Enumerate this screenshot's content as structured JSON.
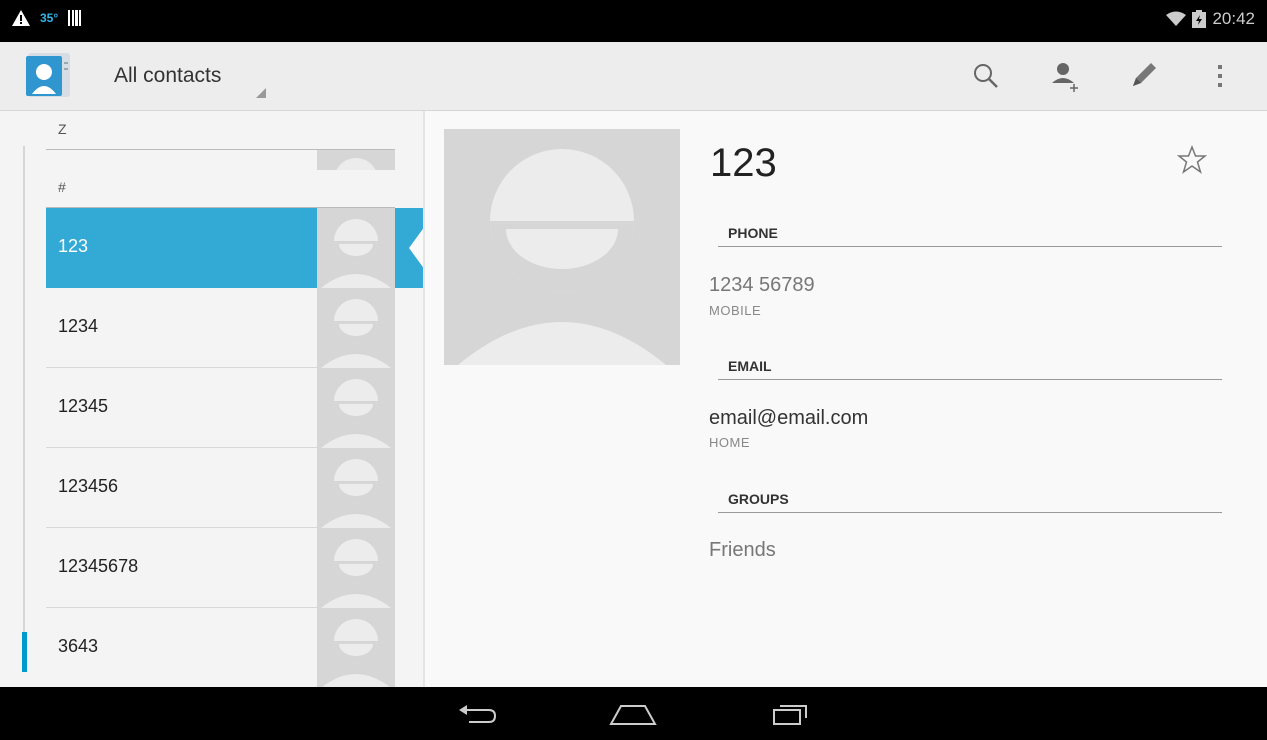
{
  "status_bar": {
    "time": "20:42",
    "temperature": "35°",
    "icons": [
      "warning-icon",
      "temperature-icon",
      "barcode-icon",
      "wifi-icon",
      "battery-icon"
    ]
  },
  "action_bar": {
    "filter_label": "All contacts",
    "actions": [
      "search-icon",
      "add-contact-icon",
      "edit-icon",
      "overflow-menu-icon"
    ]
  },
  "contact_list": {
    "sections": [
      "Z",
      "#"
    ],
    "items": [
      "123",
      "1234",
      "12345",
      "123456",
      "12345678",
      "3643"
    ],
    "selected": "123"
  },
  "detail": {
    "name": "123",
    "sections": {
      "phone": {
        "header": "PHONE",
        "value": "1234 56789",
        "type": "MOBILE"
      },
      "email": {
        "header": "EMAIL",
        "value": "email@email.com",
        "type": "HOME"
      },
      "groups": {
        "header": "GROUPS",
        "value": "Friends"
      }
    }
  },
  "nav_bar": {
    "buttons": [
      "back-icon",
      "home-icon",
      "recent-apps-icon"
    ]
  },
  "colors": {
    "accent": "#33a9d6",
    "scroll": "#0099cc"
  }
}
